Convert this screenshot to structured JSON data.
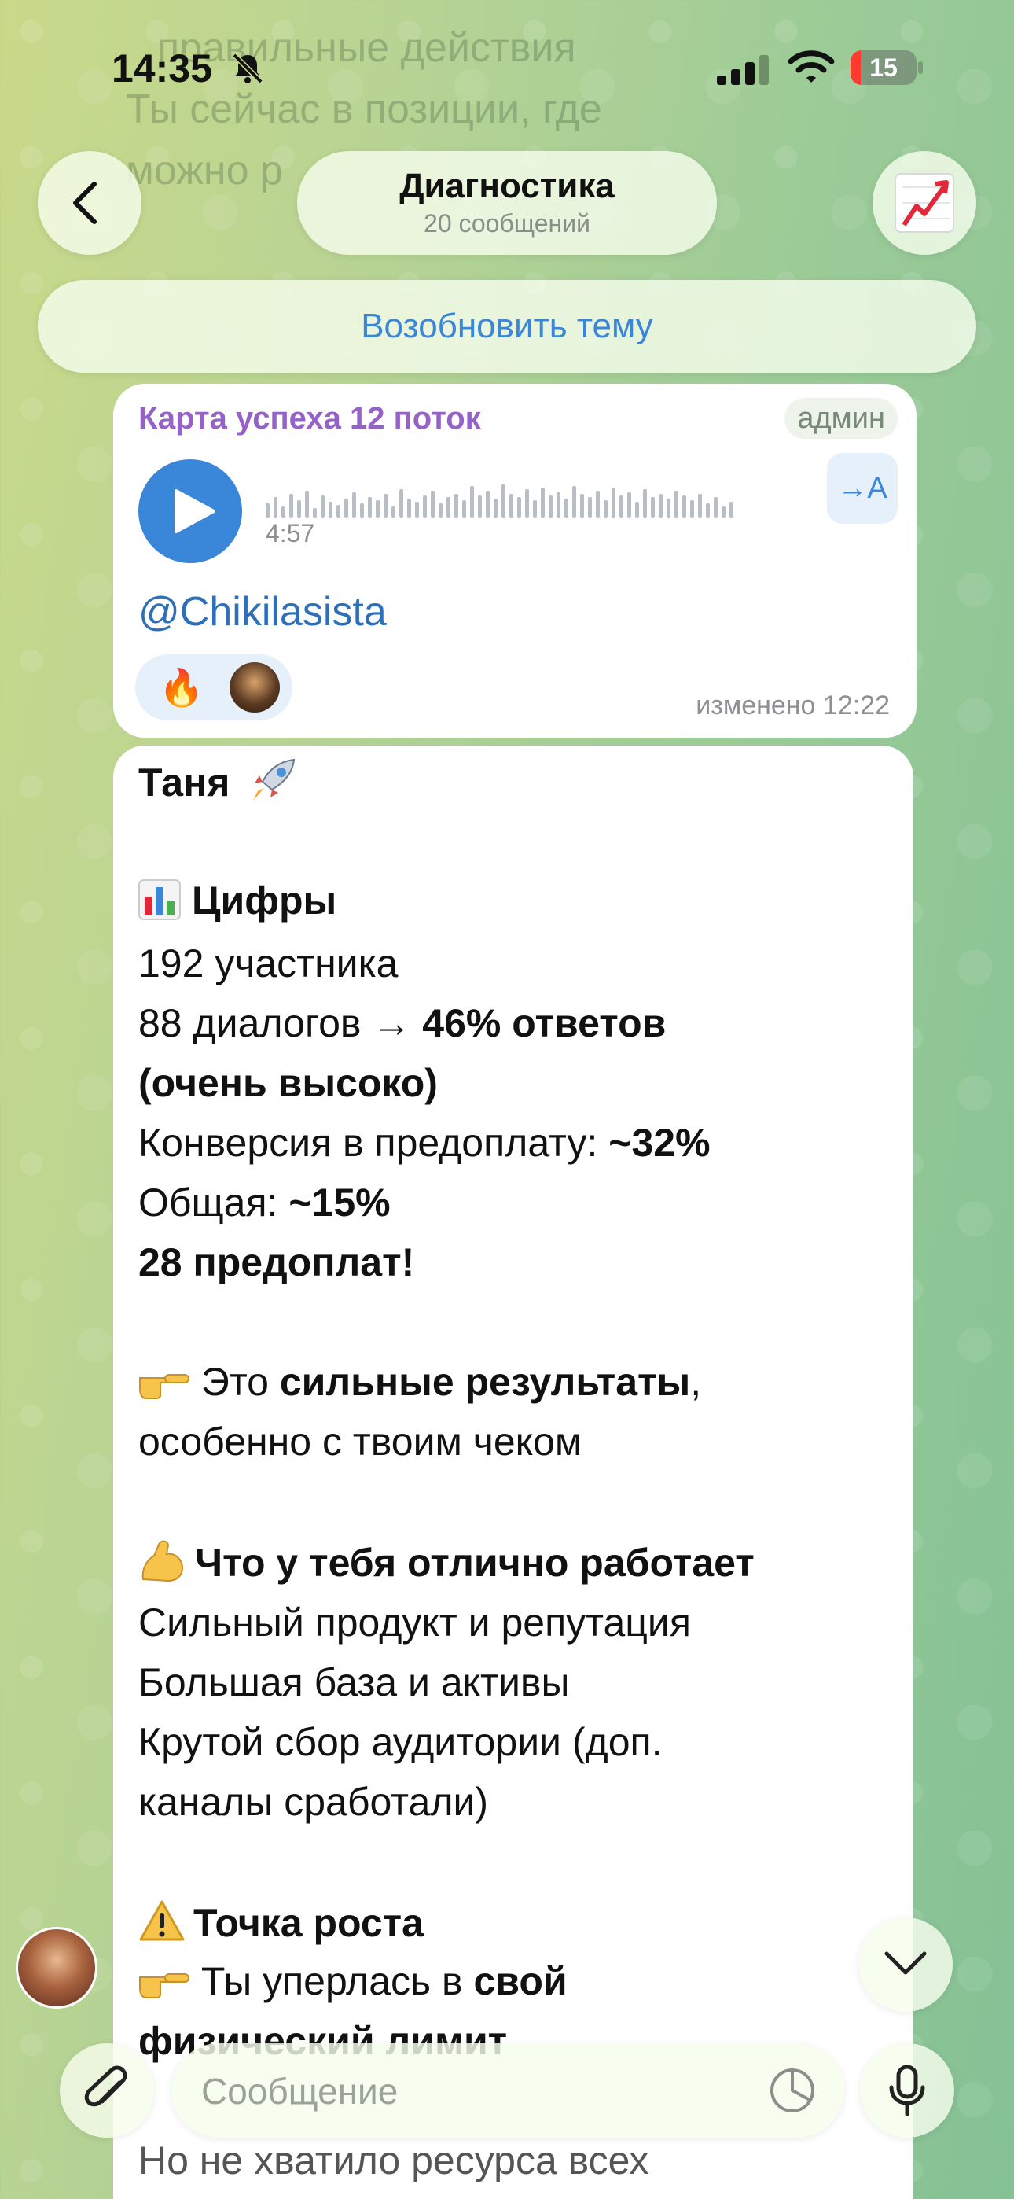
{
  "status_bar": {
    "time": "14:35",
    "battery": "15",
    "battery_level_percent": 15
  },
  "background_text": {
    "line1": "правильные действия",
    "line2": "Ты сейчас в позиции, где",
    "line3": "можно р"
  },
  "header": {
    "title": "Диагностика",
    "subtitle": "20 сообщений",
    "resume_label": "Возобновить тему"
  },
  "message_voice": {
    "sender": "Карта успеха 12 поток",
    "badge": "админ",
    "duration": "4:57",
    "translate_label": "→A",
    "mention": "@Chikilasista",
    "reaction_emoji": "🔥",
    "edited": "изменено 12:22"
  },
  "message_text": {
    "greeting": "Таня",
    "s1_title": "Цифры",
    "s1_line1": "192 участника",
    "s1_line2a": "88 диалогов → ",
    "s1_line2b": "46% ответов",
    "s1_line3": "(очень высоко)",
    "s1_line4a": "Конверсия в предоплату: ",
    "s1_line4b": "~32%",
    "s1_line5a": "Общая: ",
    "s1_line5b": "~15%",
    "s1_line6": "28 предоплат!",
    "s2_a": " Это ",
    "s2_b": "сильные результаты",
    "s2_c": ",",
    "s2_line2": "особенно с твоим чеком",
    "s3_title": "Что у тебя отлично работает",
    "s3_line1": "Сильный продукт и репутация",
    "s3_line2": "Большая база и активы",
    "s3_line3": "Крутой сбор аудитории (доп.",
    "s3_line4": "каналы сработали)",
    "s4_title": "Точка роста",
    "s4_line1a": " Ты уперлась в ",
    "s4_line1b": "свой",
    "s4_line2": "физический лимит",
    "s4_line4": "Но не хватило ресурса всех"
  },
  "composer": {
    "placeholder": "Сообщение"
  }
}
